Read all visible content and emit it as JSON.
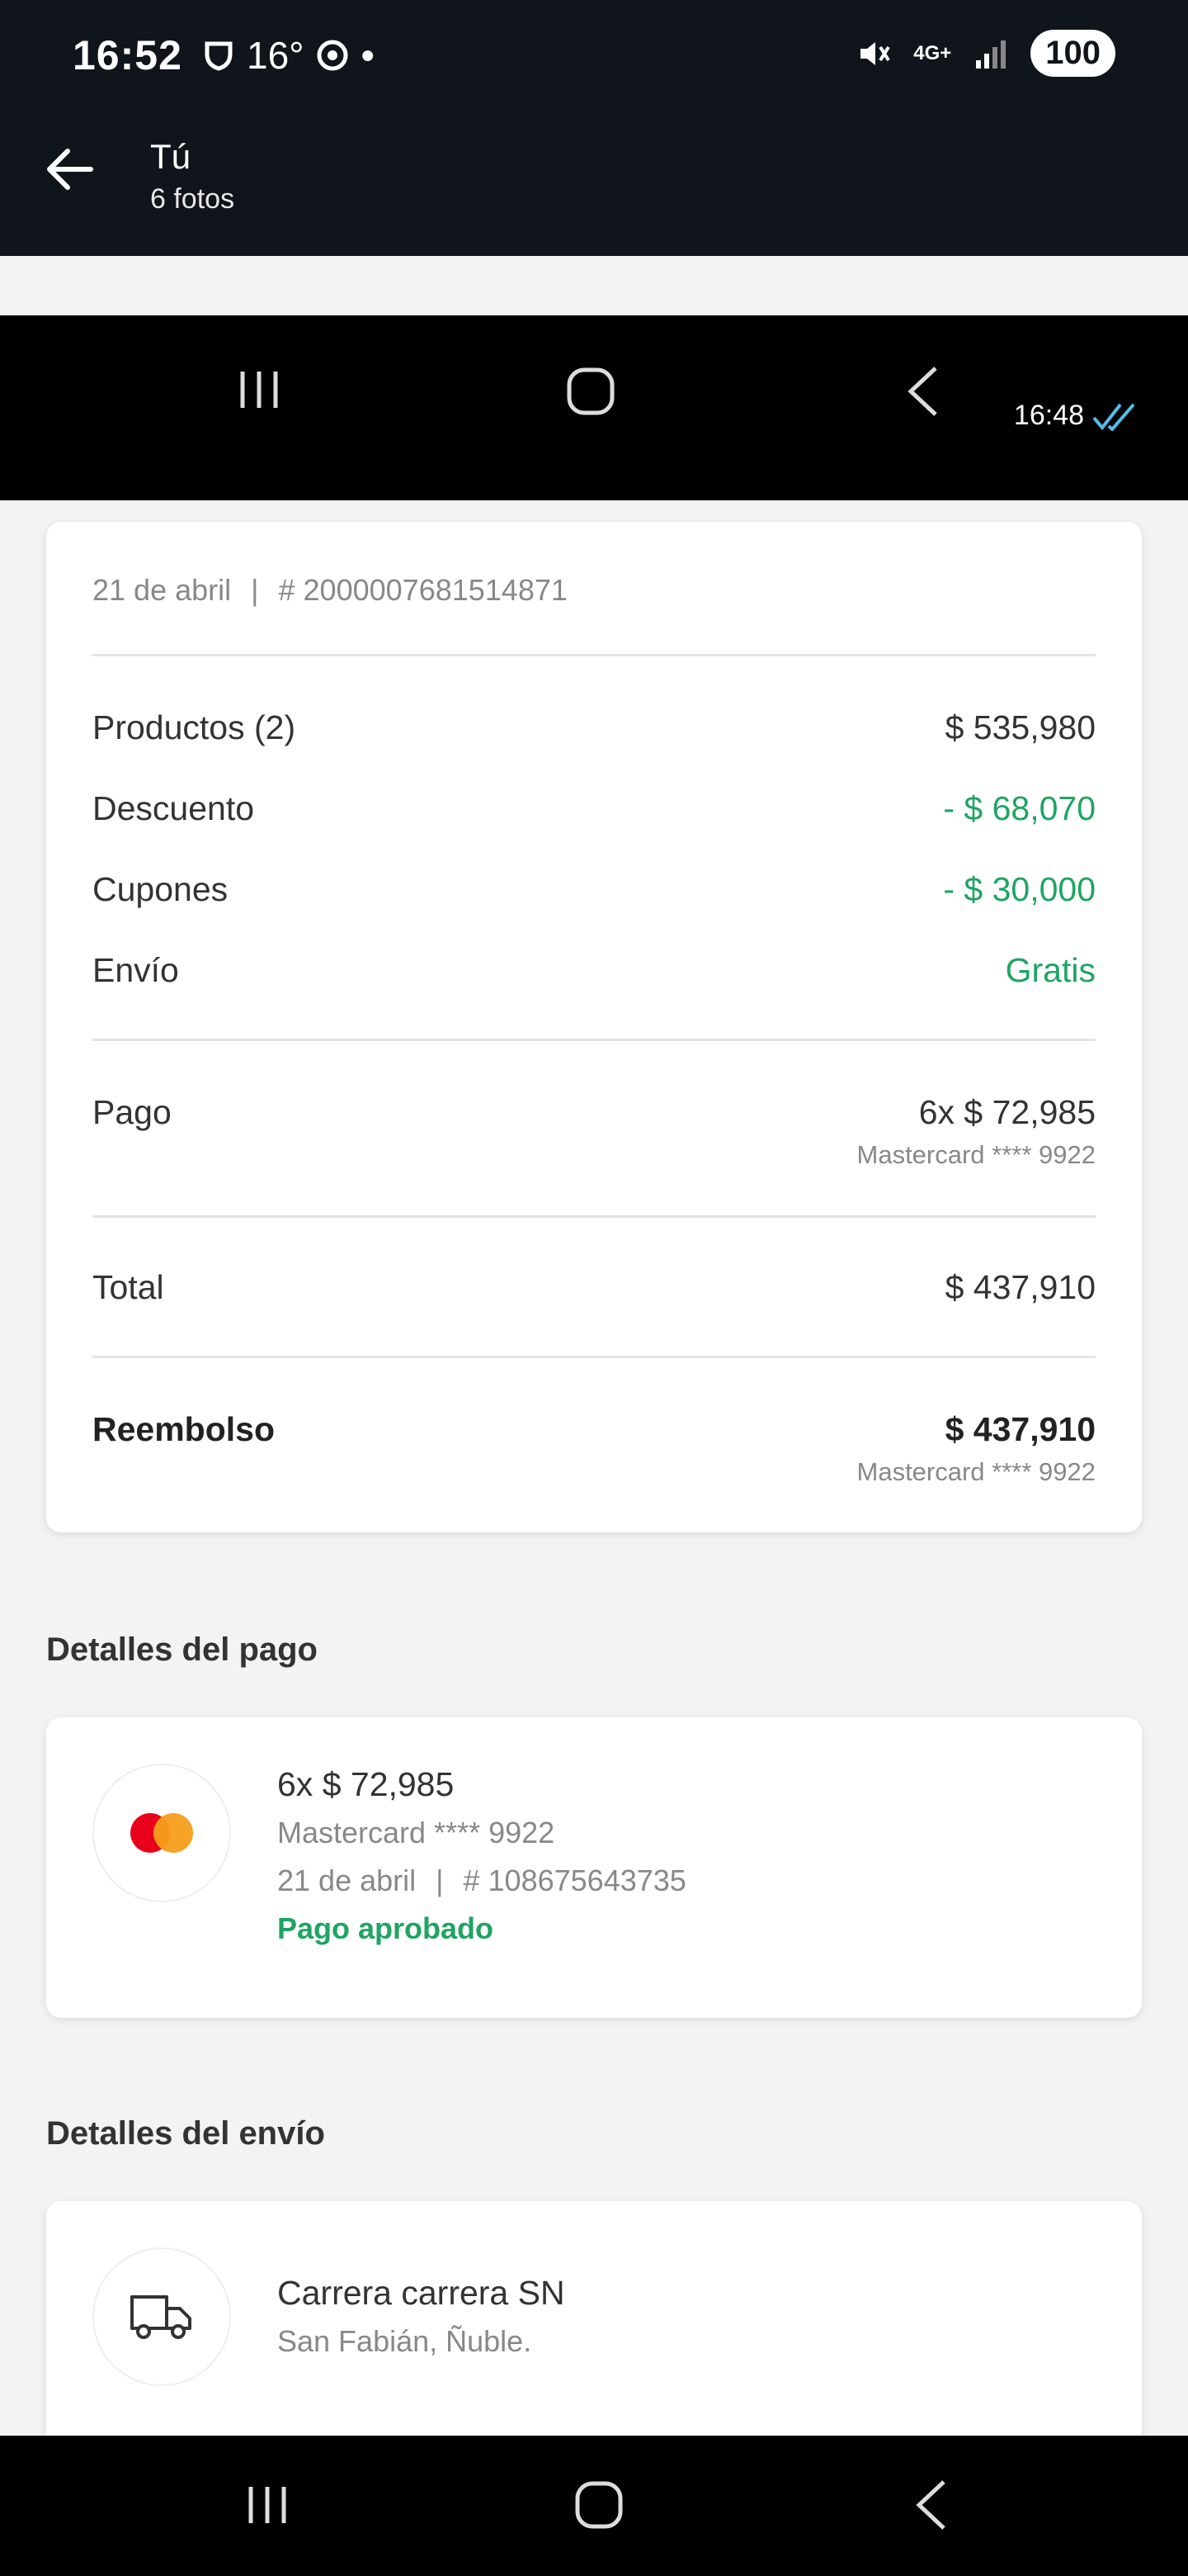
{
  "status_bar": {
    "time": "16:52",
    "temp": "16°",
    "network": "4G+",
    "battery": "100"
  },
  "app_bar": {
    "title": "Tú",
    "subtitle": "6 fotos"
  },
  "inner_bar": {
    "time": "16:48"
  },
  "summary": {
    "date": "21 de abril",
    "order_number": "# 2000007681514871",
    "rows": [
      {
        "label": "Productos (2)",
        "value": "$ 535,980"
      },
      {
        "label": "Descuento",
        "value": "- $ 68,070"
      },
      {
        "label": "Cupones",
        "value": "- $ 30,000"
      },
      {
        "label": "Envío",
        "value": "Gratis"
      }
    ],
    "payment": {
      "label": "Pago",
      "value": "6x $ 72,985",
      "card": "Mastercard **** 9922"
    },
    "total": {
      "label": "Total",
      "value": "$ 437,910"
    },
    "refund": {
      "label": "Reembolso",
      "value": "$ 437,910",
      "card": "Mastercard **** 9922"
    }
  },
  "payment_details": {
    "title": "Detalles del pago",
    "amount": "6x $ 72,985",
    "card": "Mastercard **** 9922",
    "date": "21 de abril",
    "op_number": "# 108675643735",
    "status": "Pago aprobado"
  },
  "shipping_details": {
    "title": "Detalles del envío",
    "address": "Carrera carrera SN",
    "city": "San Fabián, Ñuble."
  },
  "colors": {
    "green": "#1fa463",
    "mastercard_red": "#eb001b",
    "mastercard_orange": "#f79e1b"
  }
}
